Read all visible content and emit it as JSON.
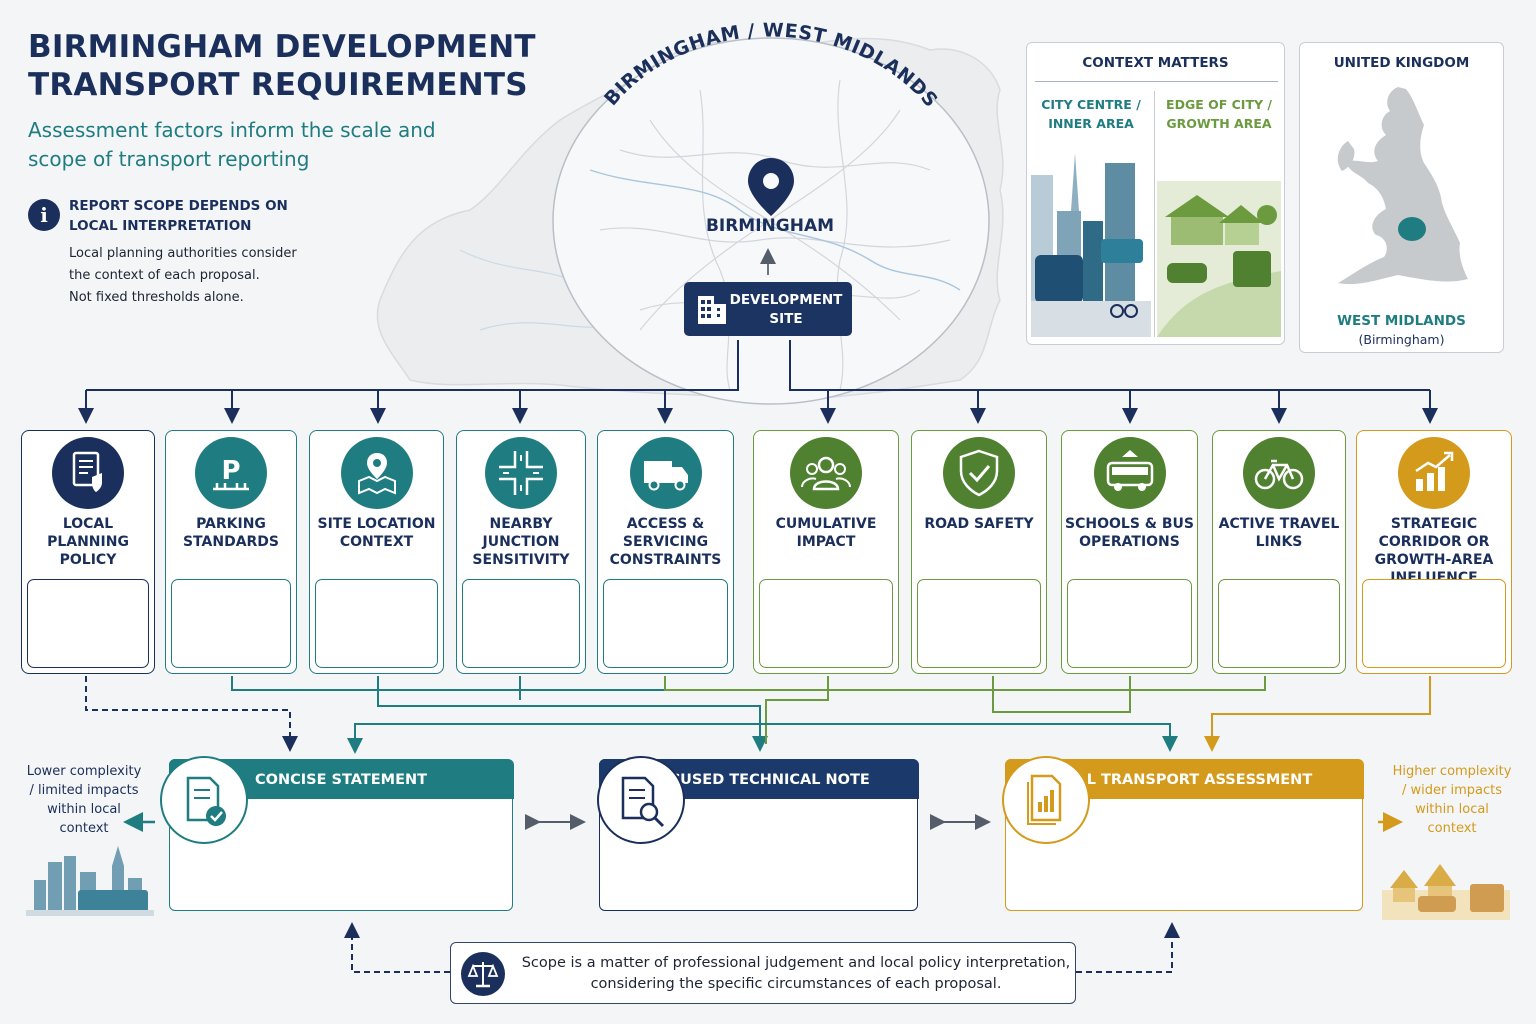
{
  "header": {
    "title_line1": "BIRMINGHAM DEVELOPMENT",
    "title_line2": "TRANSPORT REQUIREMENTS",
    "subtitle": "Assessment factors inform the scale and scope of transport reporting"
  },
  "info_note": {
    "heading": "REPORT SCOPE DEPENDS ON LOCAL INTERPRETATION",
    "lines": [
      "Local planning authorities consider",
      "the context of each proposal.",
      "Not fixed thresholds alone."
    ]
  },
  "map": {
    "arc_title": "BIRMINGHAM / WEST MIDLANDS",
    "city": "BIRMINGHAM",
    "site_label": "DEVELOPMENT SITE"
  },
  "context_panel": {
    "title": "CONTEXT MATTERS",
    "left_label": "CITY CENTRE / INNER AREA",
    "right_label": "EDGE OF CITY / GROWTH AREA"
  },
  "uk_panel": {
    "title": "UNITED KINGDOM",
    "region": "WEST MIDLANDS",
    "region_sub": "(Birmingham)"
  },
  "factors": [
    {
      "label": "LOCAL PLANNING POLICY",
      "icon": "policy-document-icon"
    },
    {
      "label": "PARKING STANDARDS",
      "icon": "parking-icon"
    },
    {
      "label": "SITE LOCATION CONTEXT",
      "icon": "map-pin-icon"
    },
    {
      "label": "NEARBY JUNCTION SENSITIVITY",
      "icon": "junction-icon"
    },
    {
      "label": "ACCESS & SERVICING CONSTRAINTS",
      "icon": "truck-icon"
    },
    {
      "label": "CUMULATIVE IMPACT",
      "icon": "people-group-icon"
    },
    {
      "label": "ROAD SAFETY",
      "icon": "shield-check-icon"
    },
    {
      "label": "SCHOOLS & BUS OPERATIONS",
      "icon": "school-bus-icon"
    },
    {
      "label": "ACTIVE TRAVEL LINKS",
      "icon": "bicycle-icon"
    },
    {
      "label": "STRATEGIC CORRIDOR OR GROWTH-AREA INFLUENCE",
      "icon": "growth-chart-icon"
    }
  ],
  "reports": {
    "concise": "CONCISE STATEMENT",
    "focused": "FOCUSED TECHNICAL NOTE",
    "full": "FULL TRANSPORT ASSESSMENT"
  },
  "scale_notes": {
    "lower": "Lower complexity / limited impacts within local context",
    "higher": "Higher complexity / wider impacts within local context"
  },
  "judgement": "Scope is a matter of professional judgement and local policy interpretation, considering the specific circumstances of each proposal.",
  "colors": {
    "navy": "#1b2f5c",
    "teal": "#1f7d82",
    "green": "#6b9a3f",
    "gold": "#d49a1c"
  }
}
